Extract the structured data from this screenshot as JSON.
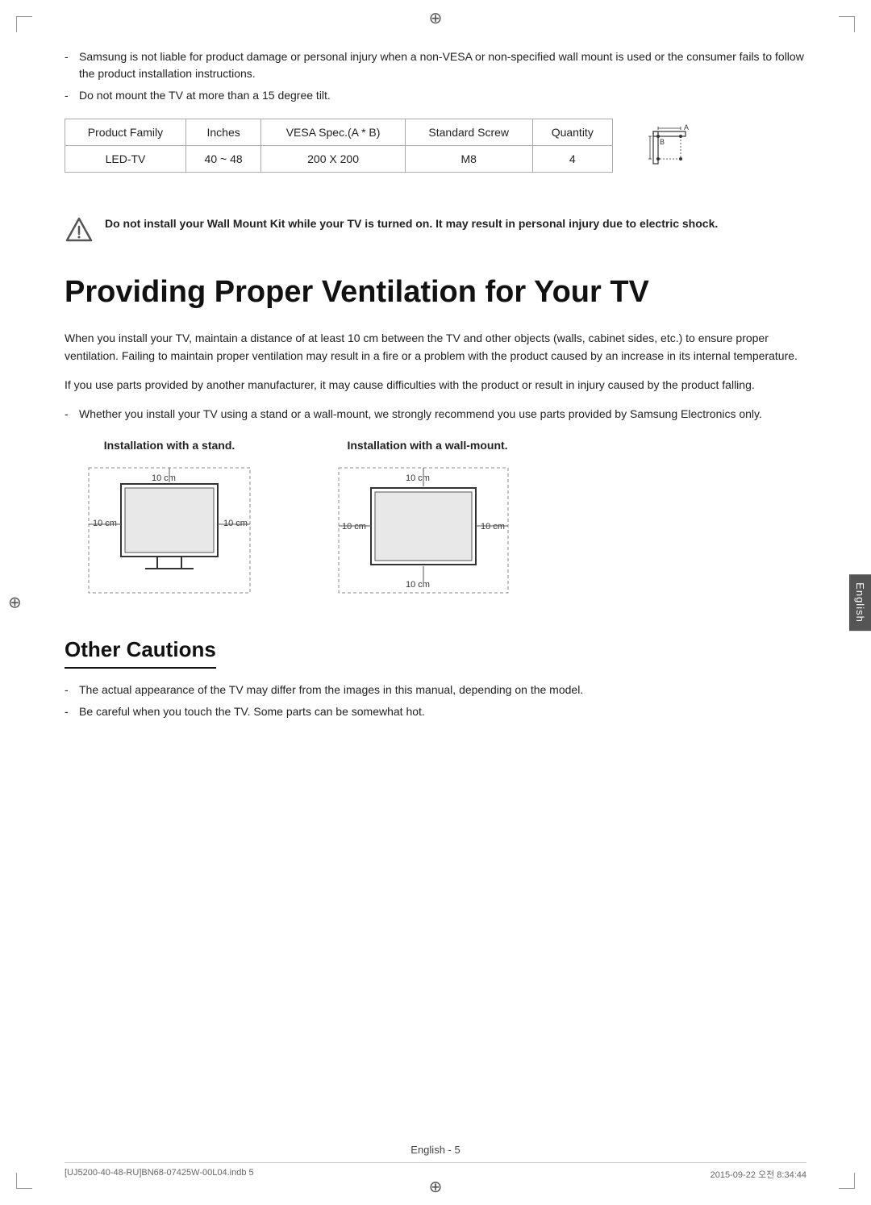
{
  "page": {
    "language_label": "English",
    "crosshair_symbol": "⊕"
  },
  "bullets_top": [
    "Samsung is not liable for product damage or personal injury when a non-VESA or non-specified wall mount is used or the consumer fails to follow the product installation instructions.",
    "Do not mount the TV at more than a 15 degree tilt."
  ],
  "table": {
    "headers": [
      "Product Family",
      "Inches",
      "VESA Spec.(A * B)",
      "Standard Screw",
      "Quantity"
    ],
    "rows": [
      [
        "LED-TV",
        "40 ~ 48",
        "200 X 200",
        "M8",
        "4"
      ]
    ]
  },
  "warning": {
    "text": "Do not install your Wall Mount Kit while your TV is turned on. It may result in personal injury due to electric shock."
  },
  "main_section": {
    "heading": "Providing Proper Ventilation for Your TV",
    "paragraphs": [
      "When you install your TV, maintain a distance of at least 10 cm between the TV and other objects (walls, cabinet sides, etc.) to ensure proper ventilation. Failing to maintain proper ventilation may result in a fire or a problem with the product caused by an increase in its internal temperature.",
      "If you use parts provided by another manufacturer, it may cause difficulties with the product or result in injury caused by the product falling."
    ],
    "bullet": "Whether you install your TV using a stand or a wall-mount, we strongly recommend you use parts provided by Samsung Electronics only."
  },
  "installation": {
    "stand_label": "Installation with a stand.",
    "wall_label": "Installation with a wall-mount.",
    "cm_label": "10 cm"
  },
  "other_cautions": {
    "heading": "Other Cautions",
    "bullets": [
      "The actual appearance of the TV may differ from the images in this manual, depending on the model.",
      "Be careful when you touch the TV. Some parts can be somewhat hot."
    ]
  },
  "footer": {
    "center": "English - 5",
    "left": "[UJ5200-40-48-RU]BN68-07425W-00L04.indb   5",
    "right": "2015-09-22   오전 8:34:44"
  }
}
